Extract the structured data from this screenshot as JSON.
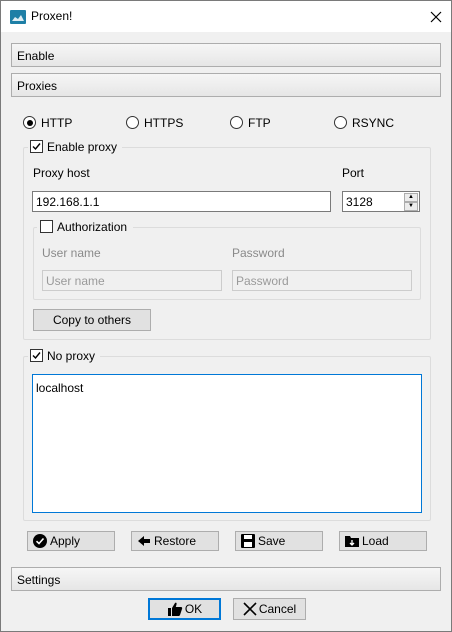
{
  "window": {
    "title": "Proxen!"
  },
  "sections": {
    "enable": "Enable",
    "proxies": "Proxies",
    "settings": "Settings"
  },
  "protocols": [
    {
      "label": "HTTP",
      "selected": true
    },
    {
      "label": "HTTPS",
      "selected": false
    },
    {
      "label": "FTP",
      "selected": false
    },
    {
      "label": "RSYNC",
      "selected": false
    }
  ],
  "proxy": {
    "enable_label": "Enable proxy",
    "enabled": true,
    "host_label": "Proxy host",
    "host_value": "192.168.1.1",
    "port_label": "Port",
    "port_value": "3128"
  },
  "auth": {
    "label": "Authorization",
    "checked": false,
    "username_label": "User name",
    "username_placeholder": "User name",
    "password_label": "Password",
    "password_placeholder": "Password"
  },
  "copy_button": "Copy to others",
  "noproxy": {
    "label": "No proxy",
    "checked": true,
    "value": "localhost"
  },
  "actions": {
    "apply": "Apply",
    "restore": "Restore",
    "save": "Save",
    "load": "Load"
  },
  "dialog": {
    "ok": "OK",
    "cancel": "Cancel"
  },
  "colors": {
    "accent": "#0078d7",
    "icon": "#1e7fa6"
  }
}
